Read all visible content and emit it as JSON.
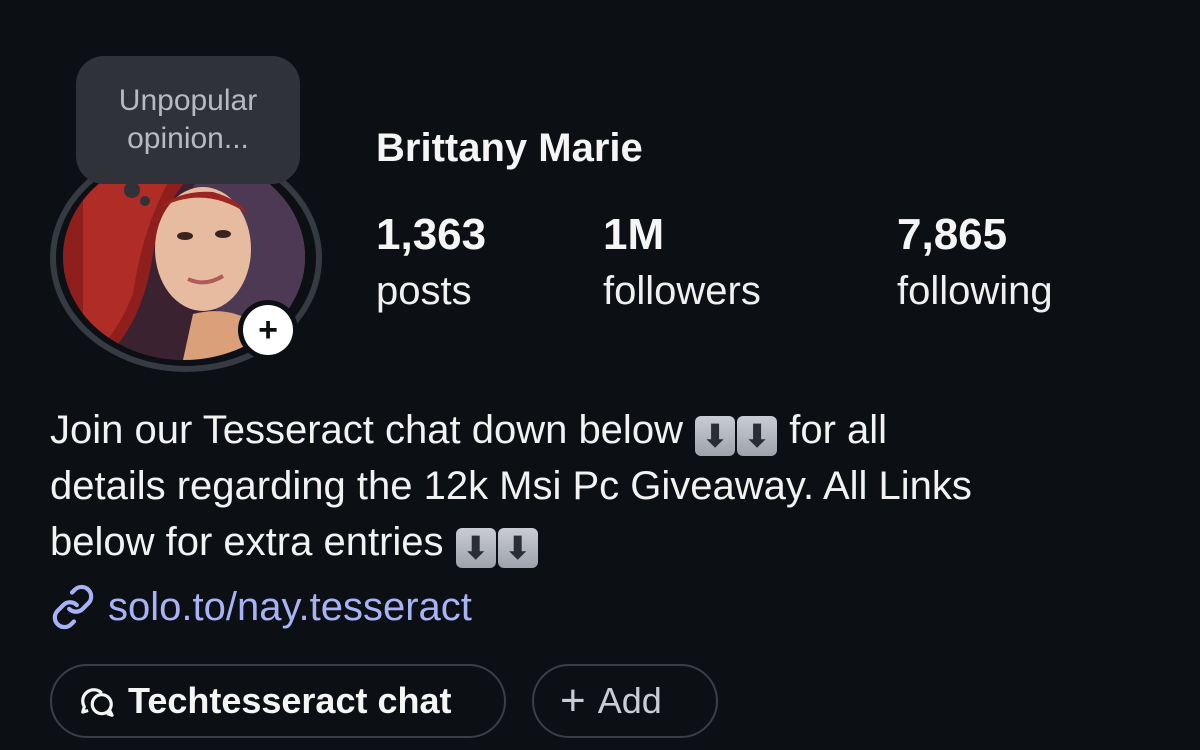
{
  "profile": {
    "name": "Brittany Marie",
    "note": "Unpopular opinion...",
    "add_story_icon": "plus-icon",
    "stats": {
      "posts": {
        "value": "1,363",
        "label": "posts"
      },
      "followers": {
        "value": "1M",
        "label": "followers"
      },
      "following": {
        "value": "7,865",
        "label": "following"
      }
    },
    "bio": {
      "line1": "Join our Tesseract chat down below",
      "line1_after": "for all",
      "line2": "details regarding the 12k Msi Pc Giveaway. All Links",
      "line3": "below for extra entries",
      "arrow_emoji": "⬇"
    },
    "link": {
      "text": "solo.to/nay.tesseract",
      "icon": "link-icon"
    },
    "chips": {
      "chat_label": "Techtesseract chat",
      "chat_icon": "chat-bubbles-icon",
      "add_label": "Add",
      "add_icon": "plus-icon"
    }
  },
  "colors": {
    "background": "#0c0f14",
    "link": "#a8b3f5",
    "note_bubble": "#2f3238",
    "ring": "#363a42"
  }
}
